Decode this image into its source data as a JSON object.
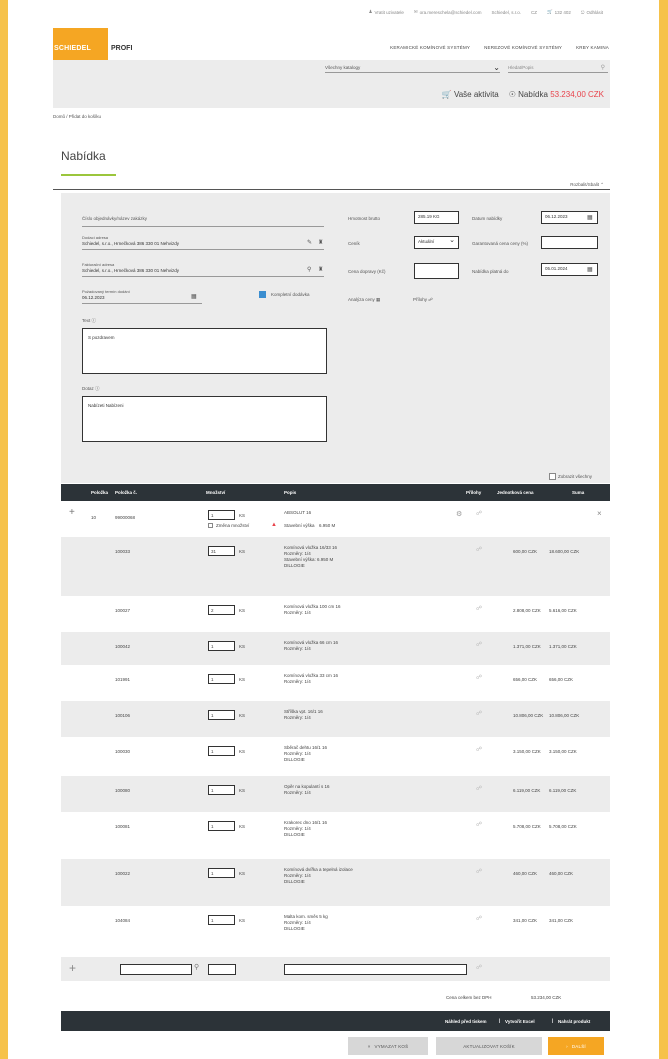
{
  "topbar": {
    "user": "Vratit uzivatele",
    "email": "ora.mereschela@schiedel.com",
    "company": "Schiedel, s.r.o.",
    "lang": "CZ",
    "cart": "132 402",
    "logout": "Odhlásit"
  },
  "brand": {
    "logo": "SCHIEDEL",
    "sub": "PROFI",
    "accent": "#f5a623"
  },
  "nav": [
    "KERAMICKÉ KOMÍNOVÉ SYSTÉMY",
    "NEREZOVÉ KOMÍNOVÉ SYSTÉMY",
    "KRBY KAMINA"
  ],
  "search": {
    "catalog": "Všechny katalogy",
    "placeholder": "Hledat/Popis"
  },
  "cartline": {
    "activity": "Vaše aktivita",
    "offer_label": "Nabídka",
    "offer_amount": "53.234,00 CZK"
  },
  "breadcrumb": "Domů / Přidat do košíku",
  "page_title": "Nabídka",
  "collapse_label": "Rozbalit/Sbalit",
  "form": {
    "project_label": "Číslo objednávky/název zakázky",
    "delivery_label": "Dodací adresa",
    "delivery_value": "Schiedel, s.r.o., Hrnečková 386 330 01 Nehvizdy",
    "invoice_label": "Fakturační adresa",
    "invoice_value": "Schiedel, s.r.o., Hrnečková 386 330 01 Nehvizdy",
    "date_label": "Požadovaný termín dodání",
    "date_value": "06.12.2023",
    "complete_label": "Kompletní dodávka",
    "text_label": "Text",
    "text_value": "S pozdravem",
    "note_label": "Dotaz",
    "note_value": "Nabízeti Nabízeni",
    "weight_label": "Hmotnost brutto",
    "weight_value": "285.19 KG",
    "offer_date_label": "Datum nabídky",
    "offer_date_value": "06.12.2023",
    "pricelist_label": "Ceník",
    "pricelist_value": "Aktuální",
    "price_label": "Garantovaná cena ceny (%)",
    "discount_label": "Cena dopravy (Kč)",
    "valid_label": "Nabídka platná do",
    "valid_value": "05.01.2024",
    "analysis_label": "Analýza ceny",
    "attach_label": "Přílohy",
    "show_all_label": "Zobrazit všechny"
  },
  "table": {
    "headers": [
      "Položka",
      "Položka č.",
      "Množství",
      "Popis",
      "Přílohy",
      "Jednotková cena",
      "Suma"
    ],
    "main": {
      "pos": "10",
      "num": "99000068",
      "qty": "1",
      "unit": "KS",
      "title": "ABSOLUT 16",
      "change_label": "Změna množství",
      "height_label": "Stavební výška",
      "height_value": "6.950 M"
    },
    "rows": [
      {
        "num": "100033",
        "qty": "31",
        "unit": "KS",
        "desc": [
          "Komínová vložka 16/33 16",
          "Rozměry: 1/4",
          "Stavební výška: 6.950 M",
          "DILLOGIE"
        ],
        "unit_price": "600,00 CZK",
        "sum": "18.600,00 CZK"
      },
      {
        "num": "100027",
        "qty": "2",
        "unit": "KS",
        "desc": [
          "Komínová vložka 100 cm 16",
          "Rozměry: 1/4"
        ],
        "unit_price": "2.808,00 CZK",
        "sum": "5.616,00 CZK"
      },
      {
        "num": "100042",
        "qty": "1",
        "unit": "KS",
        "desc": [
          "Komínová vložka 66 cm 16",
          "Rozměry: 1/4"
        ],
        "unit_price": "1.371,00 CZK",
        "sum": "1.371,00 CZK"
      },
      {
        "num": "101991",
        "qty": "1",
        "unit": "KS",
        "desc": [
          "Komínová vložka 33 cm 16",
          "Rozměry: 1/4"
        ],
        "unit_price": "656,00 CZK",
        "sum": "656,00 CZK"
      },
      {
        "num": "100106",
        "qty": "1",
        "unit": "KS",
        "desc": [
          "Stříška vpt. 16/1 16",
          "Rozměry: 1/4"
        ],
        "unit_price": "10.806,00 CZK",
        "sum": "10.806,00 CZK"
      },
      {
        "num": "100030",
        "qty": "1",
        "unit": "KS",
        "desc": [
          "Sběrač dehtu 16/1 16",
          "Rozměry: 1/4",
          "DILLOGIE"
        ],
        "unit_price": "3.150,00 CZK",
        "sum": "3.150,00 CZK"
      },
      {
        "num": "100080",
        "qty": "1",
        "unit": "KS",
        "desc": [
          "Opěr na kopulantí s 16",
          "Rozměry: 1/4"
        ],
        "unit_price": "6.119,00 CZK",
        "sum": "6.119,00 CZK"
      },
      {
        "num": "100081",
        "qty": "1",
        "unit": "KS",
        "desc": [
          "Krakorec dno 16/1 16",
          "Rozměry: 1/4",
          "DILLOGIE"
        ],
        "unit_price": "5.708,00 CZK",
        "sum": "5.708,00 CZK"
      },
      {
        "num": "100022",
        "qty": "1",
        "unit": "KS",
        "desc": [
          "Komínová dvířka a tepelná izolace",
          "Rozměry: 1/4",
          "DILLOGIE"
        ],
        "unit_price": "460,00 CZK",
        "sum": "460,00 CZK"
      },
      {
        "num": "104084",
        "qty": "1",
        "unit": "KS",
        "desc": [
          "Malta kom. směs 5 kg",
          "Rozměry: 1/4",
          "DILLOGIE"
        ],
        "unit_price": "341,00 CZK",
        "sum": "341,00 CZK"
      }
    ]
  },
  "summary": {
    "label": "Cena celkem bez DPH",
    "value": "53.234,00 CZK"
  },
  "footer_links": [
    "Náhled před tiskem",
    "Vytvořit Excel",
    "Nahrát produkt"
  ],
  "buttons": {
    "delete": "VYMAZAT KOŠ",
    "update": "AKTUALIZOVAT KOŠÍK",
    "next": "DALŠÍ"
  }
}
